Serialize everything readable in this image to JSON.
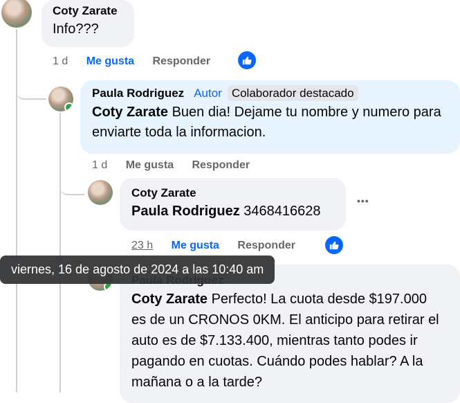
{
  "comments": [
    {
      "author": "Coty Zarate",
      "text": "Info???",
      "time": "1 d",
      "like_label": "Me gusta",
      "reply_label": "Responder"
    },
    {
      "author": "Paula Rodriguez",
      "author_badge": "Autor",
      "contributor_badge": "Colaborador destacado",
      "mention": "Coty Zarate",
      "text": " Buen dia! Dejame tu nombre y numero para enviarte toda la informacion.",
      "time": "1 d",
      "like_label": "Me gusta",
      "reply_label": "Responder"
    },
    {
      "author": "Coty Zarate",
      "mention": "Paula Rodriguez",
      "text": " 3468416628",
      "time": "23 h",
      "like_label": "Me gusta",
      "reply_label": "Responder",
      "more": "•••"
    },
    {
      "author": "Paula Rodriguez",
      "mention": "Coty Zarate",
      "text": " Perfecto! La cuota desde $197.000 es de un CRONOS 0KM. El anticipo para retirar el auto es de $7.133.400, mientras tanto podes ir pagando en cuotas. Cuándo podes hablar? A la mañana o a la tarde?"
    }
  ],
  "tooltip": "viernes, 16 de agosto de 2024 a las 10:40 am",
  "colors": {
    "accent": "#0866ff",
    "bubble": "#f0f2f5",
    "bubble_highlight": "#e7f3ff",
    "online": "#31a24c"
  },
  "icons": {
    "like": "thumbs-up-icon",
    "more": "more-options-icon"
  }
}
